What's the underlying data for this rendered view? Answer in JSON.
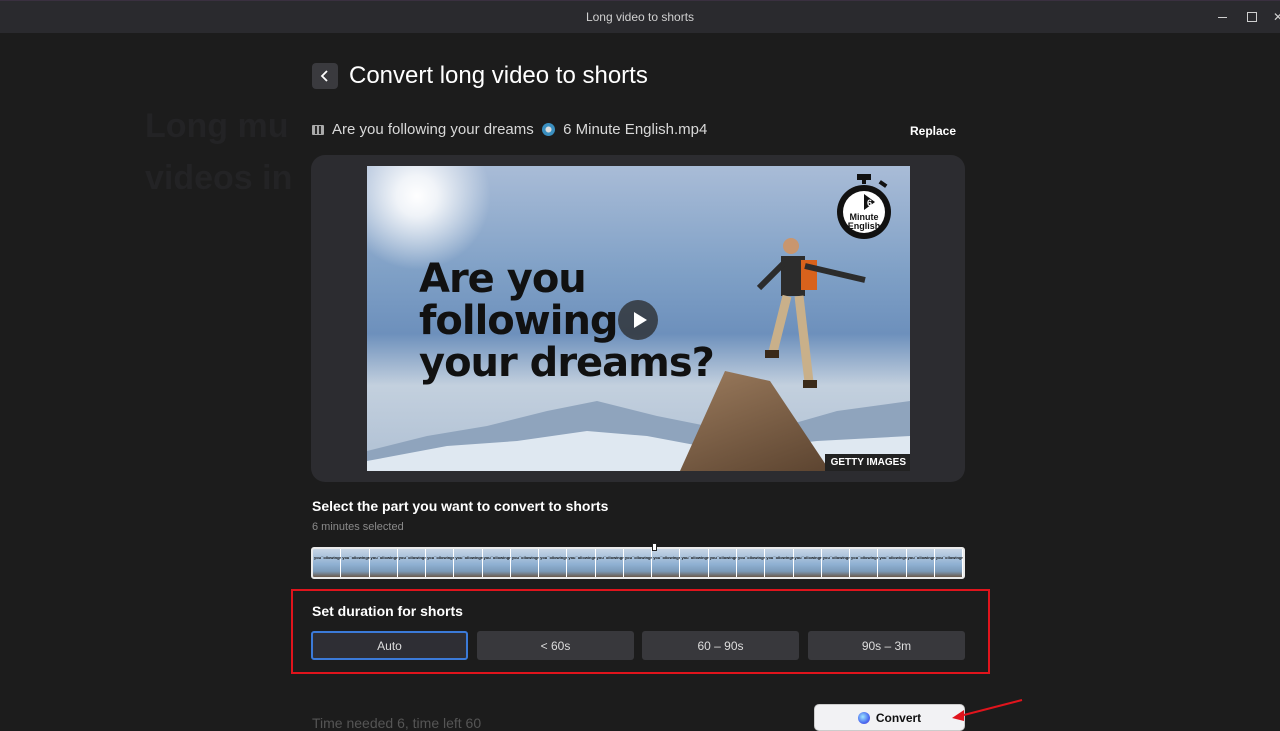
{
  "window": {
    "title": "Long video to shorts",
    "controls": [
      "minimize-icon",
      "maximize-icon",
      "close-icon"
    ]
  },
  "background_ghost_text": "Long mu\nvideos in",
  "header": {
    "back_icon": "chevron-left-icon",
    "title": "Convert long video to shorts"
  },
  "file": {
    "icon": "film-icon",
    "name_part1": "Are you following your dreams",
    "name_emoji": "clock-emoji",
    "name_part2": "6 Minute English.mp4",
    "replace_label": "Replace"
  },
  "video": {
    "headline_lines": [
      "Are you",
      "following",
      "your dreams?"
    ],
    "logo_number": "6",
    "logo_line1": "Minute",
    "logo_line2": "English",
    "credit": "GETTY IMAGES",
    "play_icon": "play-icon"
  },
  "selection": {
    "title": "Select the part you want to convert to shorts",
    "subtitle": "6 minutes selected",
    "thumbnail_count": 23
  },
  "duration": {
    "title": "Set duration for shorts",
    "options": [
      {
        "label": "Auto",
        "selected": true
      },
      {
        "label": "< 60s",
        "selected": false
      },
      {
        "label": "60 – 90s",
        "selected": false
      },
      {
        "label": "90s – 3m",
        "selected": false
      }
    ]
  },
  "footer": {
    "time_text": "Time needed 6, time left 60",
    "convert_label": "Convert"
  },
  "annotations": {
    "highlight_color": "#e0141c",
    "selected_accent": "#3b7ad8"
  }
}
